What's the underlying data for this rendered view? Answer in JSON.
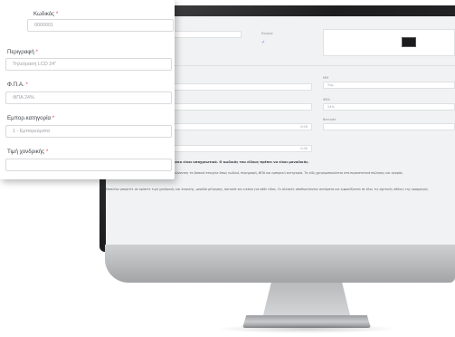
{
  "form": {
    "code": {
      "label": "Κωδικός",
      "required": "*",
      "value": "0000001"
    },
    "description": {
      "label": "Περιγραφή",
      "required": "*",
      "value": "Τηλεόραση LCD 24\""
    },
    "vat": {
      "label": "Φ.Π.Α.",
      "required": "*",
      "value": "ΦΠΑ 24%"
    },
    "category": {
      "label": "Εμπορ.κατηγορία",
      "required": "*",
      "value": "1 - Εμπορεύματα"
    },
    "barcode": {
      "label": "Τιμή χονδρικής",
      "required": "*",
      "value": ""
    }
  },
  "screen": {
    "active_label": "Ενεργό",
    "active_check": "✓",
    "unit_label": "ΜΜ",
    "unit_value": "Τεμ.",
    "vat_label": "ΦΠΑ",
    "vat_value": "24%",
    "barcode_label": "Barcode",
    "amount1": "0.00",
    "amount2": "0.00",
    "note": "Σημείωση: Τα πεδία που έχουν αστερίσκο είναι υποχρεωτικά. Ο κωδικός του είδους πρέπει να είναι μοναδικός.",
    "para1": "Μπορείτε να δημιουργήσετε νέα είδη συμπληρώνοντας τα βασικά στοιχεία όπως κωδικό, περιγραφή, ΦΠΑ και εμπορική κατηγορία. Τα είδη χρησιμοποιούνται στα παραστατικά πώλησης και αγοράς.",
    "para2": "Επιπλέον μπορείτε να ορίσετε τιμή χονδρικής και λιανικής, μονάδα μέτρησης, barcode και εικόνα για κάθε είδος. Οι αλλαγές αποθηκεύονται αυτόματα και εμφανίζονται σε όλες τις σχετικές οθόνες της εφαρμογής."
  },
  "colors": {
    "required": "#e04b4b",
    "check": "#3b6fd6",
    "bezel": "#1d1d1f",
    "chin": "#b5b6b8"
  }
}
